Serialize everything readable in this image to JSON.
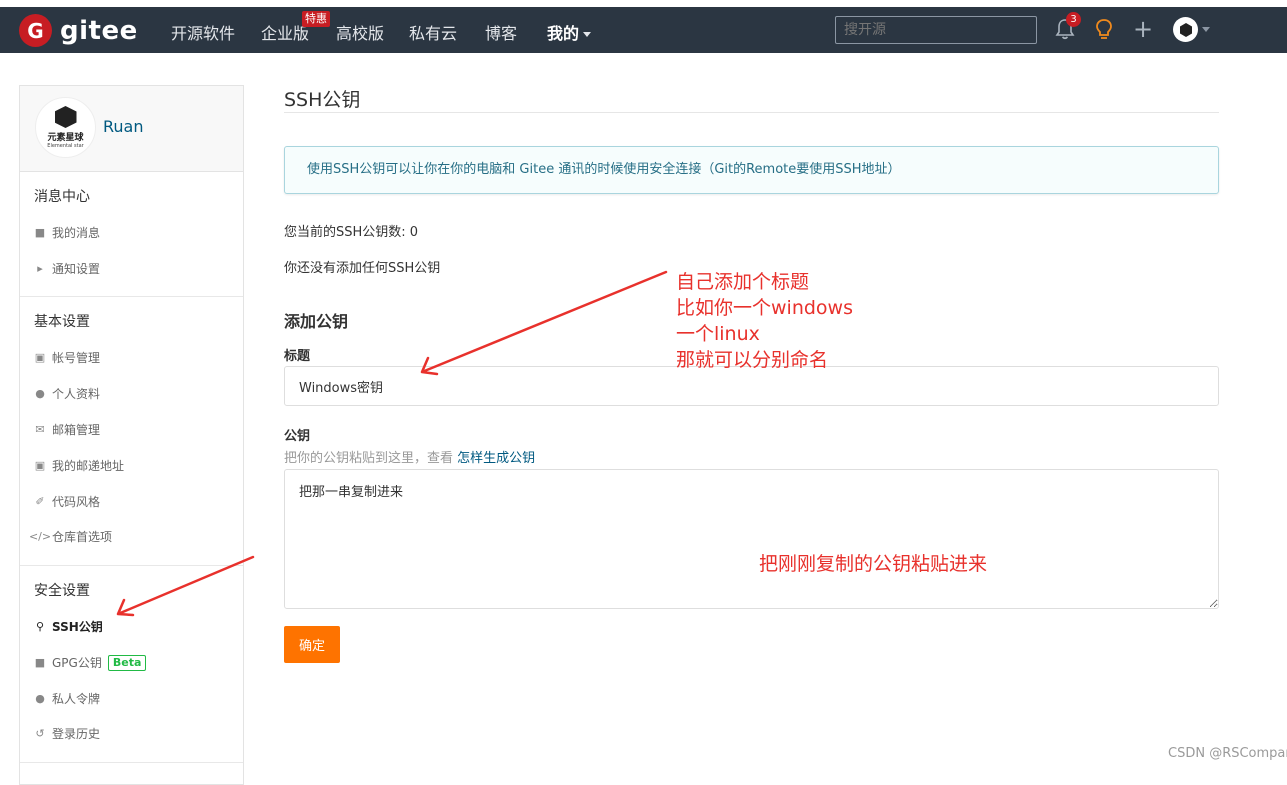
{
  "brand": {
    "name": "gitee",
    "badge": "G"
  },
  "nav": {
    "items": [
      "开源软件",
      "企业版",
      "高校版",
      "私有云",
      "博客",
      "我的"
    ],
    "enterprise_badge": "特惠",
    "search_placeholder": "搜开源",
    "notifications_count": "3"
  },
  "sidebar": {
    "username": "Ruan",
    "avatar_cn": "元素星球",
    "avatar_en": "Elemental star",
    "sections": {
      "messages": "消息中心",
      "basic": "基本设置",
      "security": "安全设置"
    },
    "items": {
      "my_messages": "我的消息",
      "notify_settings": "通知设置",
      "account": "帐号管理",
      "profile": "个人资料",
      "email_manage": "邮箱管理",
      "commit_email": "我的邮递地址",
      "code_style": "代码风格",
      "repo_prefs": "仓库首选项",
      "ssh_keys": "SSH公钥",
      "gpg_keys": "GPG公钥",
      "gpg_badge": "Beta",
      "tokens": "私人令牌",
      "login_history": "登录历史"
    }
  },
  "main": {
    "title": "SSH公钥",
    "info": "使用SSH公钥可以让你在你的电脑和 Gitee 通讯的时候使用安全连接（Git的Remote要使用SSH地址）",
    "count_text": "您当前的SSH公钥数: 0",
    "empty_text": "你还没有添加任何SSH公钥",
    "add_heading": "添加公钥",
    "title_label": "标题",
    "title_value": "Windows密钥",
    "key_label": "公钥",
    "key_hint": "把你的公钥粘贴到这里，查看",
    "key_hint_link": "怎样生成公钥",
    "key_value": "把那一串复制进来",
    "submit": "确定"
  },
  "annotations": {
    "title_note": [
      "自己添加个标题",
      "比如你一个windows",
      "一个linux",
      "那就可以分别命名"
    ],
    "key_note": "把刚刚复制的公钥粘贴进来"
  },
  "watermark": "CSDN @RSCompany",
  "colors": {
    "topbar": "#2b3642",
    "brand_red": "#c71d23",
    "button_orange": "#fe7300",
    "annotation_red": "#e8312c",
    "link_blue": "#005980"
  }
}
